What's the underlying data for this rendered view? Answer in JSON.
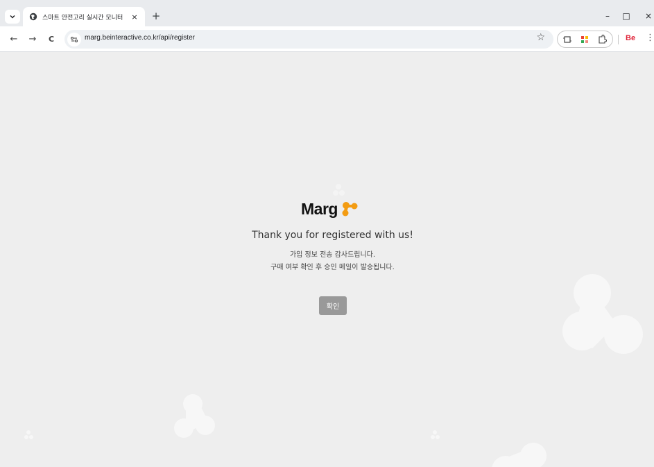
{
  "browser": {
    "tab_title": "스마트 안전고리 실시간 모니터",
    "tab_close": "×",
    "new_tab": "+",
    "url": "marg.beinteractive.co.kr/api/register",
    "window_controls": {
      "minimize": "–",
      "maximize": "□",
      "close": "×"
    },
    "nav": {
      "back": "←",
      "forward": "→",
      "reload": "C"
    },
    "icons": [
      "tab-search-icon",
      "globe-icon",
      "site-info-icon",
      "star-icon",
      "screenshot-icon",
      "color-palette-icon",
      "extensions-icon",
      "behance-icon",
      "more-menu-icon"
    ],
    "behance_label": "Be",
    "menu": "⋮"
  },
  "page": {
    "logo_text": "Marg",
    "brand_color": "#f39c12",
    "headline": "Thank you for registered with us!",
    "message_line1": "가입 정보 전송 감사드립니다.",
    "message_line2": "구매 여부 확인 후 승인 메일이 발송됩니다.",
    "confirm_label": "확인"
  }
}
